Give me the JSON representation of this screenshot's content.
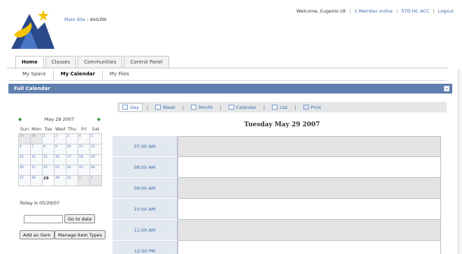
{
  "header": {
    "main_site": "Main Site",
    "separator": ":",
    "site_name": "dotLRN",
    "welcome": "Welcome, Eugenio Ull",
    "members_online": "1 Member online",
    "std_hc_acc": "STD HC ACC",
    "logout": "Logout",
    "pipe": "|"
  },
  "tabs": [
    "Home",
    "Classes",
    "Communities",
    "Control Panel"
  ],
  "subtabs": [
    "My Space",
    "My Calendar",
    "My Files"
  ],
  "panel": {
    "title": "Full Calendar"
  },
  "views": [
    "Day",
    "Week",
    "Month",
    "Calendar",
    "List",
    "Print"
  ],
  "mini_calendar": {
    "title": "May 29 2007",
    "prev": "◆",
    "next": "◆",
    "weekdays": [
      "Sun",
      "Mon",
      "Tue",
      "Wed",
      "Thu",
      "Fri",
      "Sat"
    ],
    "weeks": [
      [
        "29",
        "30",
        "1",
        "2",
        "3",
        "4",
        "5"
      ],
      [
        "6",
        "7",
        "8",
        "9",
        "10",
        "11",
        "12"
      ],
      [
        "13",
        "14",
        "15",
        "16",
        "17",
        "18",
        "19"
      ],
      [
        "20",
        "21",
        "22",
        "23",
        "24",
        "25",
        "26"
      ],
      [
        "27",
        "28",
        "29",
        "30",
        "31",
        "1",
        "2"
      ]
    ]
  },
  "today_text": "Today is 05/29/07",
  "go_to_date": "Go to date",
  "add_item": "Add an item",
  "manage_item_types": "Manage Item Types",
  "day_title": "Tuesday May 29 2007",
  "times": [
    "07:00 AM",
    "08:00 AM",
    "09:00 AM",
    "10:00 AM",
    "11:00 AM",
    "12:00 PM"
  ],
  "colors": {
    "panel_header": "#5f7fae",
    "link": "#3a6bb0",
    "time_cell": "#e2e8ef"
  }
}
